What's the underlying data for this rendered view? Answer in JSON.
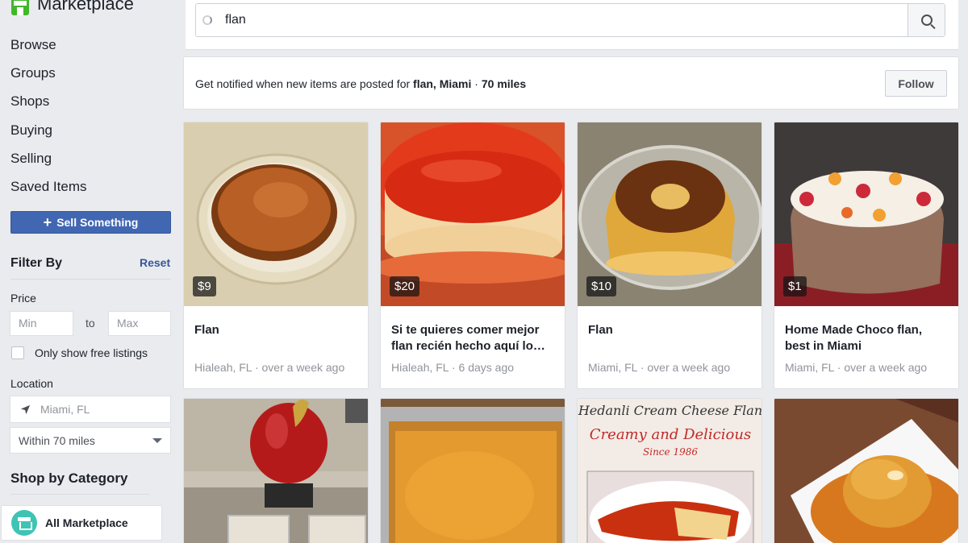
{
  "brand": {
    "title": "Marketplace"
  },
  "nav": [
    "Browse",
    "Groups",
    "Shops",
    "Buying",
    "Selling",
    "Saved Items"
  ],
  "sell_button": "Sell Something",
  "filter": {
    "title": "Filter By",
    "reset": "Reset",
    "price_label": "Price",
    "min_placeholder": "Min",
    "to_label": "to",
    "max_placeholder": "Max",
    "free_only_label": "Only show free listings",
    "location_label": "Location",
    "location_value": "Miami, FL",
    "radius_value": "Within 70 miles"
  },
  "category": {
    "title": "Shop by Category",
    "all_marketplace": "All Marketplace"
  },
  "search": {
    "query": "flan"
  },
  "notify": {
    "prefix": "Get notified when new items are posted for ",
    "query": "flan, Miami",
    "separator": " · ",
    "radius": "70 miles",
    "follow_label": "Follow"
  },
  "listings": [
    {
      "price": "$9",
      "title": "Flan",
      "meta": "Hialeah, FL · over a week ago"
    },
    {
      "price": "$20",
      "title": "Si te quieres comer mejor flan recién hecho aquí lo…",
      "meta": "Hialeah, FL · 6 days ago"
    },
    {
      "price": "$10",
      "title": "Flan",
      "meta": "Miami, FL · over a week ago"
    },
    {
      "price": "$1",
      "title": "Home Made Choco flan, best in Miami",
      "meta": "Miami, FL · over a week ago"
    }
  ],
  "image_text": {
    "line1": "Hedanli Cream Cheese Flan",
    "line2": "Creamy and Delicious",
    "line3": "Since 1986"
  }
}
